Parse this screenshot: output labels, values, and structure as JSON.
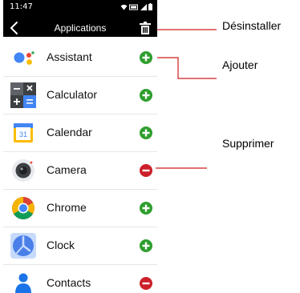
{
  "status": {
    "time": "11:47"
  },
  "appbar": {
    "title": "Applications"
  },
  "apps": [
    {
      "name": "Assistant",
      "action": "add",
      "icon": "assistant-icon"
    },
    {
      "name": "Calculator",
      "action": "add",
      "icon": "calculator-icon"
    },
    {
      "name": "Calendar",
      "action": "add",
      "icon": "calendar-icon"
    },
    {
      "name": "Camera",
      "action": "remove",
      "icon": "camera-icon"
    },
    {
      "name": "Chrome",
      "action": "add",
      "icon": "chrome-icon"
    },
    {
      "name": "Clock",
      "action": "add",
      "icon": "clock-icon"
    },
    {
      "name": "Contacts",
      "action": "remove",
      "icon": "contacts-icon"
    }
  ],
  "calendar_day": "31",
  "callouts": {
    "uninstall": "Désinstaller",
    "add": "Ajouter",
    "remove": "Supprimer"
  },
  "colors": {
    "add": "#2e9e2e",
    "remove": "#cc1f2a",
    "leader": "#d01c1c"
  }
}
